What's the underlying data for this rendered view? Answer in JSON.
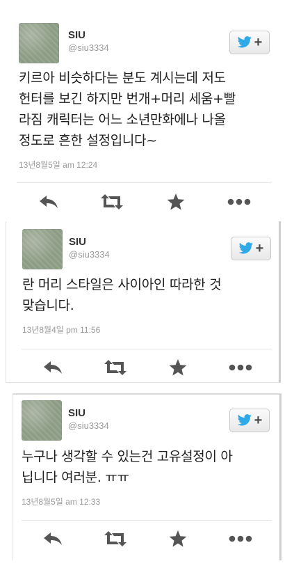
{
  "tweets": [
    {
      "name": "SIU",
      "handle": "@siu3334",
      "text": "키르아 비슷하다는 분도 계시는데 저도\n헌터를 보긴 하지만 번개+머리 세움+빨\n라짐 캐릭터는 어느 소년만화에나 나올\n정도로 흔한 설정입니다~",
      "timestamp": "13년8월5일 am 12:24"
    },
    {
      "name": "SIU",
      "handle": "@siu3334",
      "text": "란 머리 스타일은 사이아인 따라한 것\n맞습니다.",
      "timestamp": "13년8월4일 pm 11:56"
    },
    {
      "name": "SIU",
      "handle": "@siu3334",
      "text": "누구나 생각할 수 있는건 고유설정이 아\n닙니다 여러분. ㅠㅠ",
      "timestamp": "13년8월5일 am 12:33"
    }
  ],
  "follow_button": {
    "plus": "+"
  },
  "colors": {
    "twitter_blue": "#2fa9e8",
    "icon_gray": "#555555"
  },
  "icons": [
    "twitter-bird-icon",
    "reply-icon",
    "retweet-icon",
    "favorite-icon",
    "more-icon"
  ]
}
